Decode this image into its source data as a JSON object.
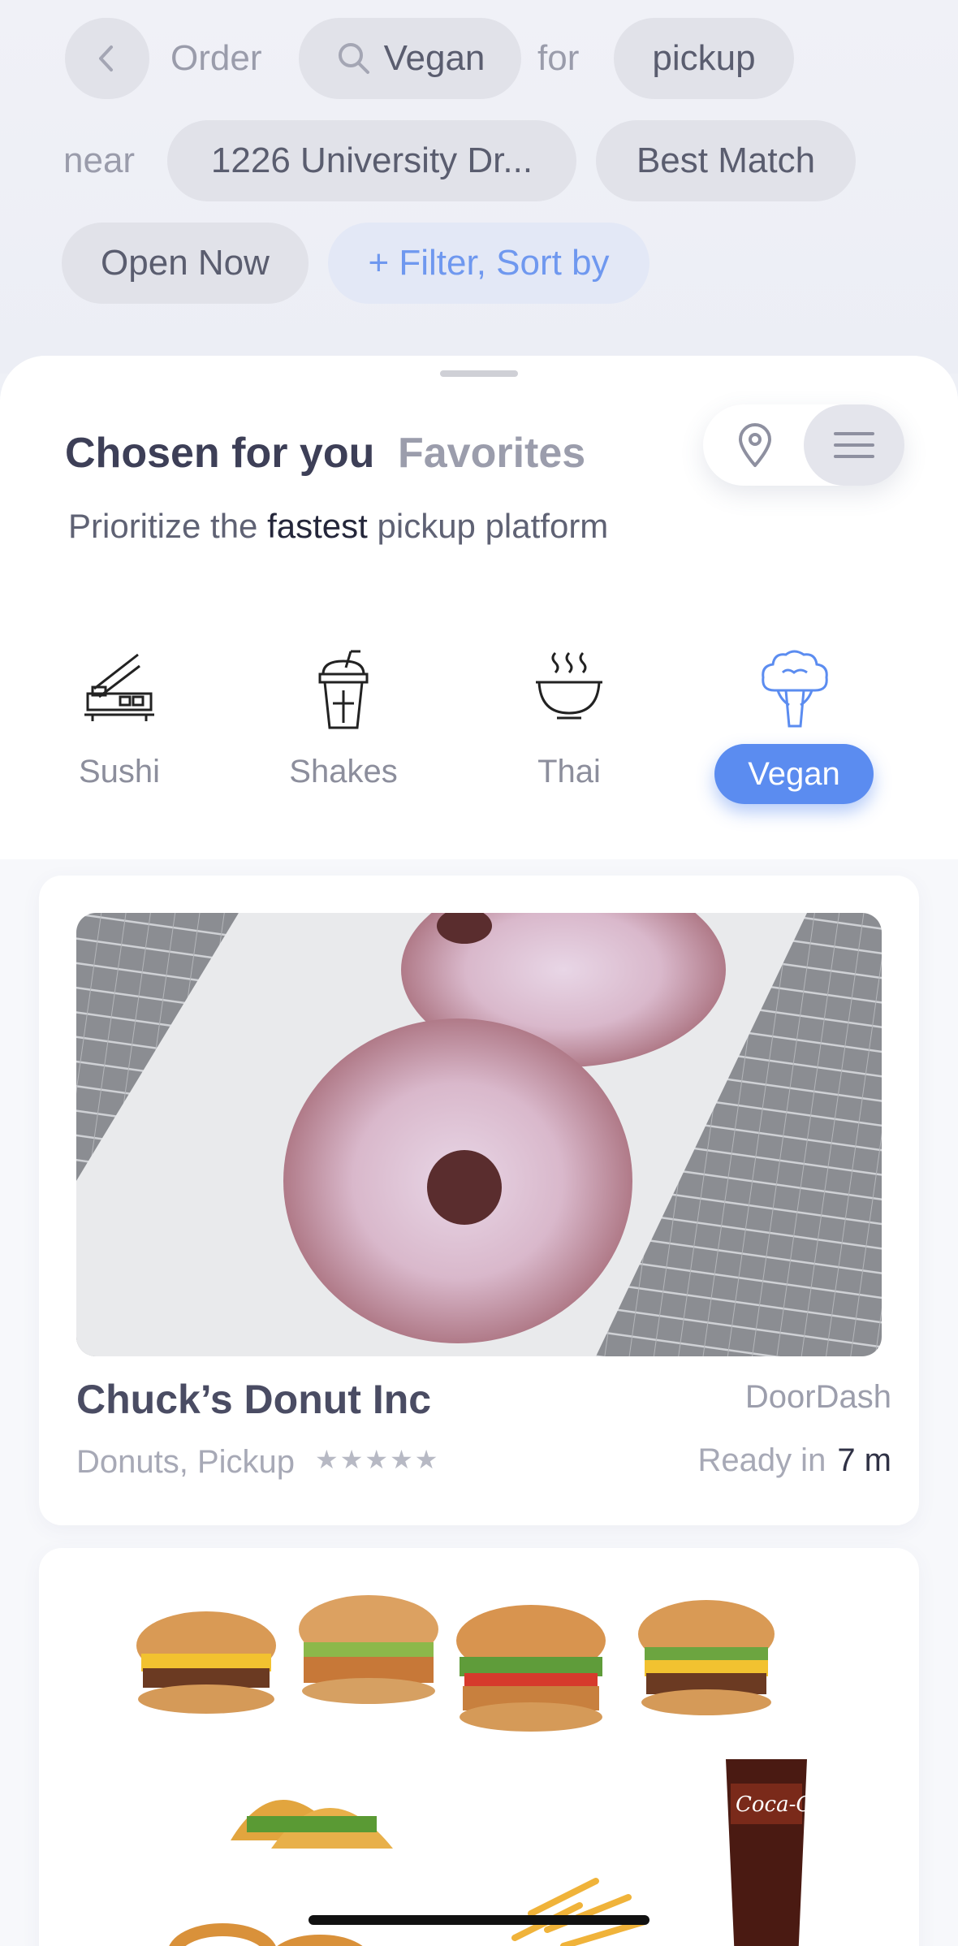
{
  "header": {
    "back_icon": "chevron-left-icon",
    "order_word": "Order",
    "search_value": "Vegan",
    "for_word": "for",
    "mode": "pickup",
    "near_word": "near",
    "address": "1226 University Dr...",
    "sort": "Best Match",
    "open_now": "Open Now",
    "filter": "+ Filter, Sort by",
    "accent_color": "#5b8cf0"
  },
  "tabs": {
    "active": "Chosen for you",
    "inactive": "Favorites"
  },
  "subtitle": {
    "prefix": "Prioritize the",
    "emphasis": "fastest",
    "suffix": "pickup platform"
  },
  "categories": [
    {
      "label": "Sushi",
      "icon": "sushi-icon"
    },
    {
      "label": "Shakes",
      "icon": "shake-icon"
    },
    {
      "label": "Thai",
      "icon": "noodle-bowl-icon"
    },
    {
      "label": "Vegan",
      "icon": "broccoli-icon",
      "selected": true
    }
  ],
  "restaurants": [
    {
      "name": "Chuck’s Donut Inc",
      "platform": "DoorDash",
      "tags": "Donuts, Pickup",
      "stars": "★★★★★",
      "ready_label": "Ready in",
      "ready_time": "7 m"
    },
    {
      "image": "burgers-tacos-cola-photo"
    }
  ]
}
